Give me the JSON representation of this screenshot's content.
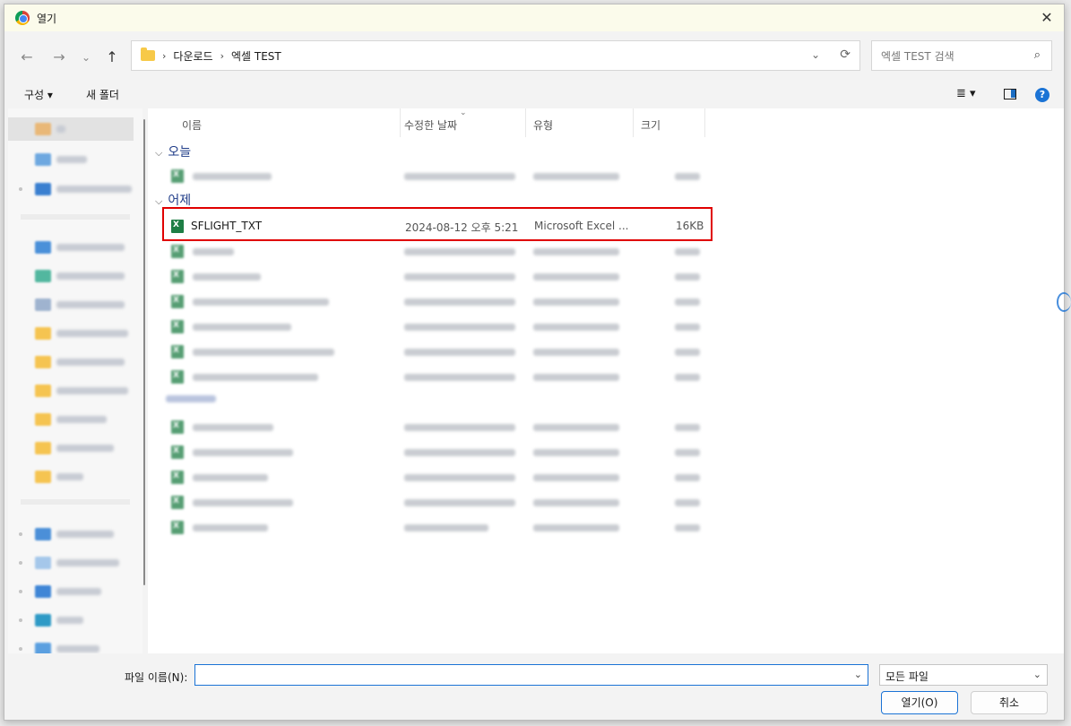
{
  "window": {
    "title": "열기",
    "close_glyph": "✕"
  },
  "nav": {
    "back": "←",
    "forward": "→",
    "recent": "⌄",
    "up": "↑",
    "breadcrumb": [
      "다운로드",
      "엑셀 TEST"
    ],
    "sep": "›",
    "dropdown": "⌄",
    "refresh": "⟳",
    "search_placeholder": "엑셀 TEST 검색",
    "search_icon": "⌕"
  },
  "toolbar": {
    "organize": "구성 ▾",
    "new_folder": "새 폴더",
    "view_menu": "≣ ▾",
    "help": "?"
  },
  "columns": {
    "name": "이름",
    "date": "수정한 날짜",
    "type": "유형",
    "size": "크기",
    "sort_glyph": "⌄"
  },
  "groups": {
    "today": "오늘",
    "yesterday": "어제",
    "group_chevron": "⌵"
  },
  "selected_file": {
    "name": "SFLIGHT_TXT",
    "date": "2024-08-12 오후 5:21",
    "type": "Microsoft Excel ...",
    "size": "16KB"
  },
  "bottom": {
    "file_name_label": "파일 이름(N):",
    "file_name_value": "",
    "file_type": "모든 파일",
    "dropdown": "⌄",
    "open_button": "열기(O)",
    "cancel_button": "취소"
  },
  "colors": {
    "accent": "#1b73d5",
    "highlight_border": "#e00000",
    "excel_green": "#1e7e45"
  }
}
